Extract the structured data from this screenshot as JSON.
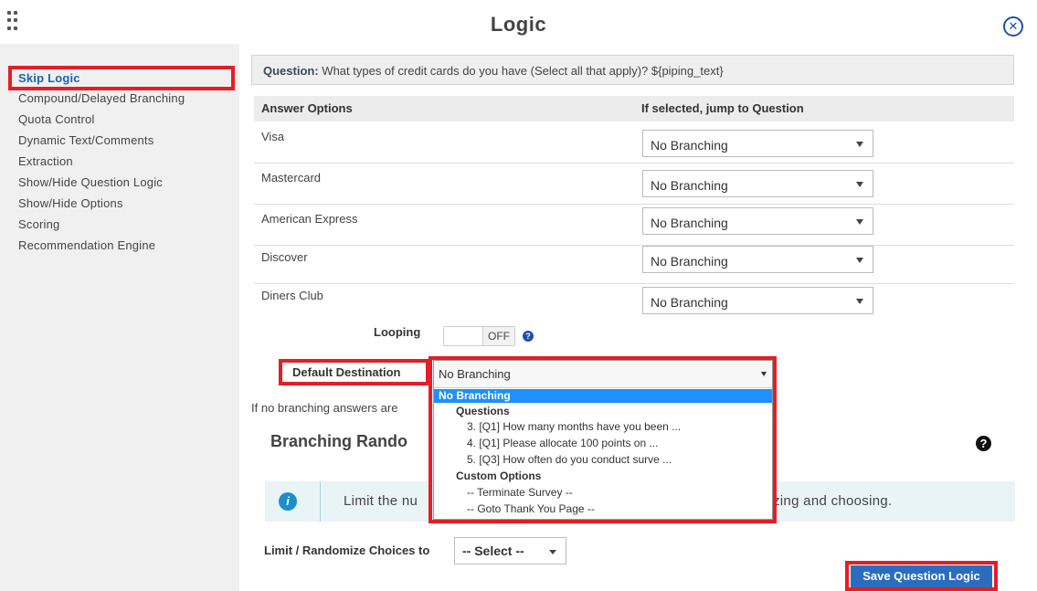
{
  "header": {
    "title": "Logic"
  },
  "sidebar": {
    "items": [
      {
        "label": "Skip Logic"
      },
      {
        "label": "Compound/Delayed Branching"
      },
      {
        "label": "Quota Control"
      },
      {
        "label": "Dynamic Text/Comments"
      },
      {
        "label": "Extraction"
      },
      {
        "label": "Show/Hide Question Logic"
      },
      {
        "label": "Show/Hide Options"
      },
      {
        "label": "Scoring"
      },
      {
        "label": "Recommendation Engine"
      }
    ]
  },
  "question": {
    "prefix": "Question:",
    "text": "What types of credit cards do you have (Select all that apply)? ${piping_text}"
  },
  "table": {
    "headers": [
      "Answer Options",
      "If selected, jump to Question"
    ],
    "rows": [
      {
        "label": "Visa",
        "value": "No Branching"
      },
      {
        "label": "Mastercard",
        "value": "No Branching"
      },
      {
        "label": "American Express",
        "value": "No Branching"
      },
      {
        "label": "Discover",
        "value": "No Branching"
      },
      {
        "label": "Diners Club",
        "value": "No Branching"
      }
    ]
  },
  "looping": {
    "label": "Looping",
    "state": "OFF"
  },
  "default_destination": {
    "label": "Default Destination",
    "value": "No Branching",
    "options": [
      {
        "text": "No Branching",
        "kind": "selected"
      },
      {
        "text": "Questions",
        "kind": "group"
      },
      {
        "text": "3. [Q1] How many months have you been ...",
        "kind": "option"
      },
      {
        "text": "4. [Q1] Please allocate 100 points on ...",
        "kind": "option"
      },
      {
        "text": "5. [Q3] How often do you conduct surve ...",
        "kind": "option"
      },
      {
        "text": "Custom Options",
        "kind": "group"
      },
      {
        "text": "-- Terminate Survey --",
        "kind": "option"
      },
      {
        "text": "-- Goto Thank You Page --",
        "kind": "option"
      }
    ]
  },
  "if_no_text": "If no branching answers are",
  "branching": {
    "title": "Branching Rando"
  },
  "info": {
    "text_left": "Limit the nu",
    "text_right": "zing and choosing.",
    "icon": "info-icon"
  },
  "limit": {
    "label": "Limit / Randomize Choices to",
    "value": "-- Select --"
  },
  "save_button": "Save Question Logic",
  "colors": {
    "accent": "#1f4fb0",
    "highlight": "#e41e26",
    "selected": "#1e90ff"
  }
}
